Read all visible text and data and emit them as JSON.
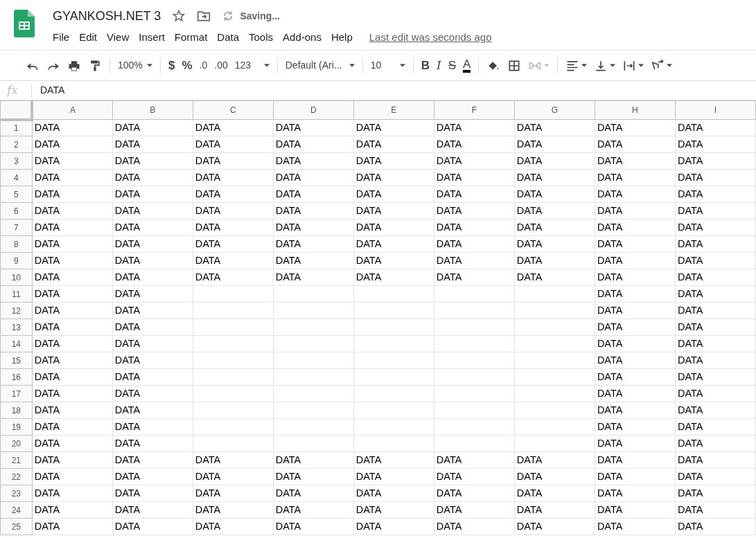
{
  "header": {
    "title": "GYANKOSH.NET 3",
    "save_status": "Saving...",
    "menu": [
      "File",
      "Edit",
      "View",
      "Insert",
      "Format",
      "Data",
      "Tools",
      "Add-ons",
      "Help"
    ],
    "last_edit": "Last edit was seconds ago"
  },
  "toolbar": [
    {
      "kind": "icon",
      "dropdown": false,
      "disabled": false
    },
    {
      "kind": "icon",
      "dropdown": false,
      "disabled": false
    },
    {
      "kind": "icon",
      "dropdown": false,
      "disabled": false
    },
    {
      "kind": "icon",
      "dropdown": false,
      "disabled": false
    },
    {
      "kind": "sep"
    },
    {
      "kind": "text",
      "label": "100%",
      "dropdown": true,
      "disabled": false
    },
    {
      "kind": "sep"
    },
    {
      "kind": "text",
      "label": "$",
      "dropdown": false,
      "disabled": false
    },
    {
      "kind": "text",
      "label": "%",
      "dropdown": false,
      "disabled": false
    },
    {
      "kind": "text",
      "label": ".0",
      "dropdown": false,
      "disabled": false
    },
    {
      "kind": "text",
      "label": ".00",
      "dropdown": false,
      "disabled": false
    },
    {
      "kind": "text",
      "label": "123",
      "dropdown": true,
      "disabled": false
    },
    {
      "kind": "sep"
    },
    {
      "kind": "text",
      "label": "Default (Ari...",
      "dropdown": true,
      "disabled": false
    },
    {
      "kind": "sep"
    },
    {
      "kind": "text",
      "label": "10",
      "dropdown": true,
      "disabled": false
    },
    {
      "kind": "sep"
    },
    {
      "kind": "text",
      "label": "B",
      "dropdown": false,
      "disabled": false
    },
    {
      "kind": "text",
      "label": "I",
      "dropdown": false,
      "disabled": false
    },
    {
      "kind": "text",
      "label": "S",
      "dropdown": false,
      "disabled": false
    },
    {
      "kind": "text",
      "label": "A",
      "dropdown": false,
      "disabled": false
    },
    {
      "kind": "sep"
    },
    {
      "kind": "icon",
      "dropdown": false,
      "disabled": false
    },
    {
      "kind": "icon",
      "dropdown": false,
      "disabled": false
    },
    {
      "kind": "icon",
      "dropdown": true,
      "disabled": true
    },
    {
      "kind": "sep"
    },
    {
      "kind": "icon",
      "dropdown": true,
      "disabled": false
    },
    {
      "kind": "icon",
      "dropdown": true,
      "disabled": false
    },
    {
      "kind": "icon",
      "dropdown": true,
      "disabled": false
    },
    {
      "kind": "icon",
      "dropdown": true,
      "disabled": false
    }
  ],
  "formula_bar": {
    "function_label": "fx",
    "value": "DATA"
  },
  "sheet": {
    "columns": [
      "A",
      "B",
      "C",
      "D",
      "E",
      "F",
      "G",
      "H",
      "I"
    ],
    "rows": [
      {
        "number": "1",
        "cells": [
          "DATA",
          "DATA",
          "DATA",
          "DATA",
          "DATA",
          "DATA",
          "DATA",
          "DATA",
          "DATA"
        ]
      },
      {
        "number": "2",
        "cells": [
          "DATA",
          "DATA",
          "DATA",
          "DATA",
          "DATA",
          "DATA",
          "DATA",
          "DATA",
          "DATA"
        ]
      },
      {
        "number": "3",
        "cells": [
          "DATA",
          "DATA",
          "DATA",
          "DATA",
          "DATA",
          "DATA",
          "DATA",
          "DATA",
          "DATA"
        ]
      },
      {
        "number": "4",
        "cells": [
          "DATA",
          "DATA",
          "DATA",
          "DATA",
          "DATA",
          "DATA",
          "DATA",
          "DATA",
          "DATA"
        ]
      },
      {
        "number": "5",
        "cells": [
          "DATA",
          "DATA",
          "DATA",
          "DATA",
          "DATA",
          "DATA",
          "DATA",
          "DATA",
          "DATA"
        ]
      },
      {
        "number": "6",
        "cells": [
          "DATA",
          "DATA",
          "DATA",
          "DATA",
          "DATA",
          "DATA",
          "DATA",
          "DATA",
          "DATA"
        ]
      },
      {
        "number": "7",
        "cells": [
          "DATA",
          "DATA",
          "DATA",
          "DATA",
          "DATA",
          "DATA",
          "DATA",
          "DATA",
          "DATA"
        ]
      },
      {
        "number": "8",
        "cells": [
          "DATA",
          "DATA",
          "DATA",
          "DATA",
          "DATA",
          "DATA",
          "DATA",
          "DATA",
          "DATA"
        ]
      },
      {
        "number": "9",
        "cells": [
          "DATA",
          "DATA",
          "DATA",
          "DATA",
          "DATA",
          "DATA",
          "DATA",
          "DATA",
          "DATA"
        ]
      },
      {
        "number": "10",
        "cells": [
          "DATA",
          "DATA",
          "DATA",
          "DATA",
          "DATA",
          "DATA",
          "DATA",
          "DATA",
          "DATA"
        ]
      },
      {
        "number": "11",
        "cells": [
          "DATA",
          "DATA",
          null,
          null,
          null,
          null,
          null,
          "DATA",
          "DATA"
        ]
      },
      {
        "number": "12",
        "cells": [
          "DATA",
          "DATA",
          null,
          null,
          null,
          null,
          null,
          "DATA",
          "DATA"
        ]
      },
      {
        "number": "13",
        "cells": [
          "DATA",
          "DATA",
          null,
          null,
          null,
          null,
          null,
          "DATA",
          "DATA"
        ]
      },
      {
        "number": "14",
        "cells": [
          "DATA",
          "DATA",
          null,
          null,
          null,
          null,
          null,
          "DATA",
          "DATA"
        ]
      },
      {
        "number": "15",
        "cells": [
          "DATA",
          "DATA",
          null,
          null,
          null,
          null,
          null,
          "DATA",
          "DATA"
        ]
      },
      {
        "number": "16",
        "cells": [
          "DATA",
          "DATA",
          null,
          null,
          null,
          null,
          null,
          "DATA",
          "DATA"
        ]
      },
      {
        "number": "17",
        "cells": [
          "DATA",
          "DATA",
          null,
          null,
          null,
          null,
          null,
          "DATA",
          "DATA"
        ]
      },
      {
        "number": "18",
        "cells": [
          "DATA",
          "DATA",
          null,
          null,
          null,
          null,
          null,
          "DATA",
          "DATA"
        ]
      },
      {
        "number": "19",
        "cells": [
          "DATA",
          "DATA",
          null,
          null,
          null,
          null,
          null,
          "DATA",
          "DATA"
        ]
      },
      {
        "number": "20",
        "cells": [
          "DATA",
          "DATA",
          null,
          null,
          null,
          null,
          null,
          "DATA",
          "DATA"
        ]
      },
      {
        "number": "21",
        "cells": [
          "DATA",
          "DATA",
          "DATA",
          "DATA",
          "DATA",
          "DATA",
          "DATA",
          "DATA",
          "DATA"
        ]
      },
      {
        "number": "22",
        "cells": [
          "DATA",
          "DATA",
          "DATA",
          "DATA",
          "DATA",
          "DATA",
          "DATA",
          "DATA",
          "DATA"
        ]
      },
      {
        "number": "23",
        "cells": [
          "DATA",
          "DATA",
          "DATA",
          "DATA",
          "DATA",
          "DATA",
          "DATA",
          "DATA",
          "DATA"
        ]
      },
      {
        "number": "24",
        "cells": [
          "DATA",
          "DATA",
          "DATA",
          "DATA",
          "DATA",
          "DATA",
          "DATA",
          "DATA",
          "DATA"
        ]
      },
      {
        "number": "25",
        "cells": [
          "DATA",
          "DATA",
          "DATA",
          "DATA",
          "DATA",
          "DATA",
          "DATA",
          "DATA",
          "DATA"
        ]
      }
    ]
  }
}
